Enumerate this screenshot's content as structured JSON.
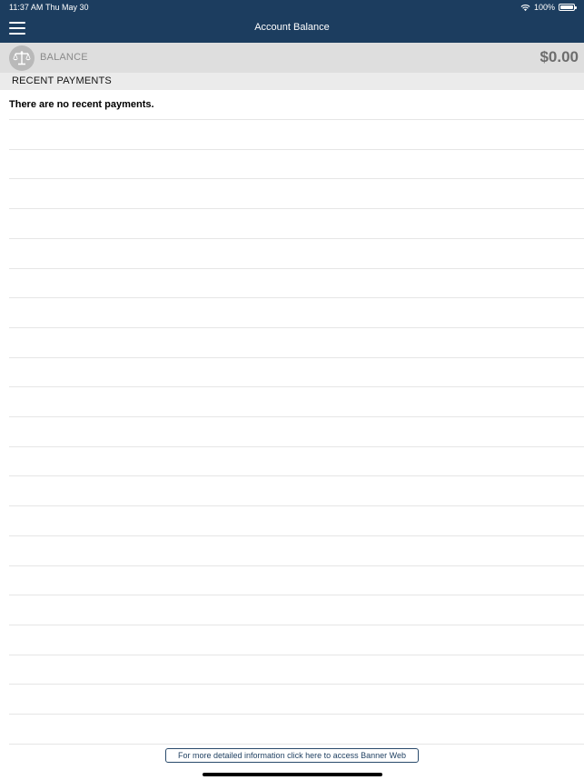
{
  "status_bar": {
    "time": "11:37 AM",
    "date": "Thu May 30",
    "battery": "100%",
    "icons": [
      "wifi-icon",
      "battery-icon"
    ]
  },
  "header": {
    "title": "Account Balance",
    "menu_icon": "hamburger-menu-icon"
  },
  "balance": {
    "icon": "scale-icon",
    "label": "BALANCE",
    "amount": "$0.00"
  },
  "recent_payments": {
    "title": "RECENT PAYMENTS",
    "empty_message": "There are no recent payments."
  },
  "footer": {
    "link_label": "For more detailed information click here to access Banner Web"
  },
  "colors": {
    "header_bg": "#1c3d5f",
    "balance_bar_bg": "#dedede",
    "section_bg": "#ebebeb"
  }
}
